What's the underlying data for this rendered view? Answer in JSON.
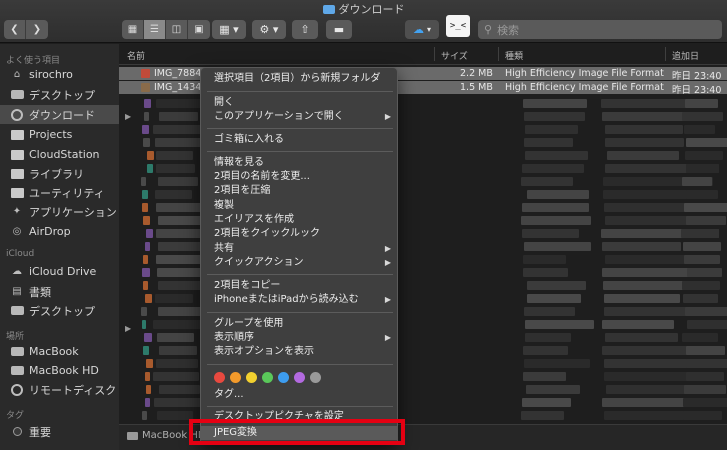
{
  "window": {
    "title": "ダウンロード"
  },
  "toolbar": {
    "search_placeholder": "検索",
    "terminal_label": ">_<"
  },
  "sidebar": {
    "favorites_heading": "よく使う項目",
    "favorites": [
      "sirochro",
      "デスクトップ",
      "ダウンロード",
      "Projects",
      "CloudStation",
      "ライブラリ",
      "ユーティリティ",
      "アプリケーション",
      "AirDrop"
    ],
    "icloud_heading": "iCloud",
    "icloud": [
      "iCloud Drive",
      "書類",
      "デスクトップ"
    ],
    "places_heading": "場所",
    "places": [
      "MacBook",
      "MacBook HD",
      "リモートディスク"
    ],
    "tags_heading": "タグ",
    "tags": [
      "重要"
    ]
  },
  "columns": {
    "name": "名前",
    "size": "サイズ",
    "kind": "種類",
    "added": "追加日"
  },
  "files": [
    {
      "name": "IMG_7884",
      "size": "2.2 MB",
      "kind": "High Efficiency Image File Format",
      "added": "昨日 23:40"
    },
    {
      "name": "IMG_1434",
      "size": "1.5 MB",
      "kind": "High Efficiency Image File Format",
      "added": "昨日 23:40"
    }
  ],
  "pathbar": {
    "label": "MacBook HD"
  },
  "context_menu": {
    "items": [
      {
        "label": "選択項目（2項目）から新規フォルダ",
        "submenu": false
      },
      {
        "label": "開く",
        "submenu": false
      },
      {
        "label": "このアプリケーションで開く",
        "submenu": true
      },
      {
        "label": "ゴミ箱に入れる",
        "submenu": false
      },
      {
        "label": "情報を見る",
        "submenu": false
      },
      {
        "label": "2項目の名前を変更...",
        "submenu": false
      },
      {
        "label": "2項目を圧縮",
        "submenu": false
      },
      {
        "label": "複製",
        "submenu": false
      },
      {
        "label": "エイリアスを作成",
        "submenu": false
      },
      {
        "label": "2項目をクイックルック",
        "submenu": false
      },
      {
        "label": "共有",
        "submenu": true
      },
      {
        "label": "クイックアクション",
        "submenu": true
      },
      {
        "label": "2項目をコピー",
        "submenu": false
      },
      {
        "label": "iPhoneまたはiPadから読み込む",
        "submenu": true
      },
      {
        "label": "グループを使用",
        "submenu": false
      },
      {
        "label": "表示順序",
        "submenu": true
      },
      {
        "label": "表示オプションを表示",
        "submenu": false
      },
      {
        "label": "タグ...",
        "submenu": false
      },
      {
        "label": "デスクトップピクチャを設定",
        "submenu": false
      },
      {
        "label": "JPEG変換",
        "submenu": false
      }
    ],
    "tag_colors": [
      "#e8493f",
      "#f39a2b",
      "#f2d02f",
      "#5ac85a",
      "#3d9df0",
      "#b36ae0",
      "#9a9a9a"
    ]
  }
}
